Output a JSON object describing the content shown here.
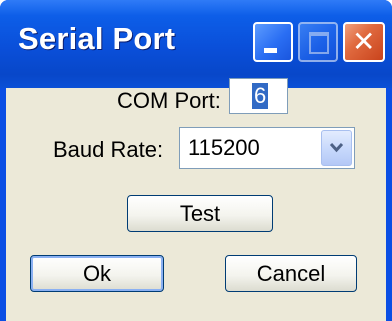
{
  "window": {
    "title": "Serial Port"
  },
  "titlebar": {
    "minimize_icon": "minimize-icon",
    "maximize_icon": "maximize-icon",
    "close_icon": "close-icon",
    "close_glyph": "✕"
  },
  "form": {
    "com_port_label": "COM Port:",
    "com_port_value": "6",
    "baud_rate_label": "Baud Rate:",
    "baud_rate_value": "115200"
  },
  "buttons": {
    "test_label": "Test",
    "ok_label": "Ok",
    "cancel_label": "Cancel"
  },
  "colors": {
    "titlebar": "#0a4fd9",
    "client": "#ece9d8",
    "selection": "#316ac5",
    "close_button": "#e06a3f"
  }
}
